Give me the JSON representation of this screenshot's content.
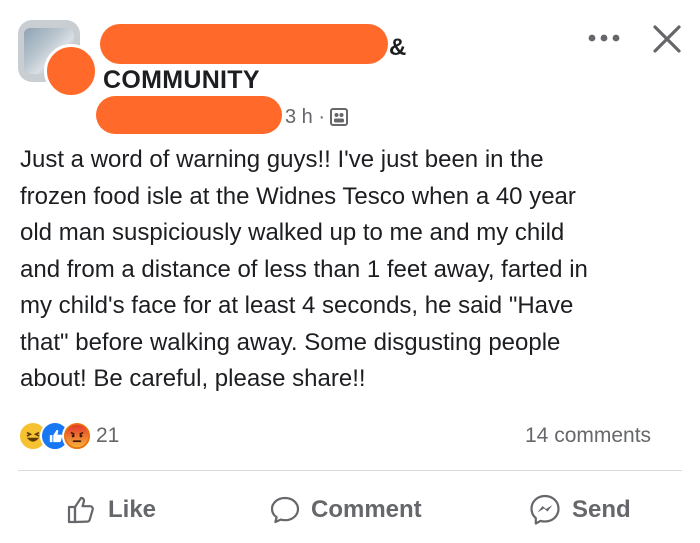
{
  "header": {
    "group_name_suffix": "&",
    "group_name": "COMMUNITY",
    "time": "3 h ·"
  },
  "post": {
    "text": "Just a word of warning guys!! I've just been in the\nfrozen food isle at the Widnes Tesco when a 40 year\nold man suspiciously walked up to me and my child\nand from a distance of less than 1 feet away, farted in\nmy child's face for at least 4 seconds, he said \"Have\nthat\" before walking away. Some disgusting people\nabout! Be careful, please share!!"
  },
  "stats": {
    "reaction_count": "21",
    "comments": "14 comments",
    "reaction_icons": [
      "haha-icon",
      "like-icon",
      "angry-icon"
    ]
  },
  "actions": {
    "like": "Like",
    "comment": "Comment",
    "send": "Send"
  },
  "colors": {
    "redaction": "#ff6a2a",
    "text": "#1c1e21",
    "muted": "#65676b",
    "like_blue": "#1877f2"
  }
}
